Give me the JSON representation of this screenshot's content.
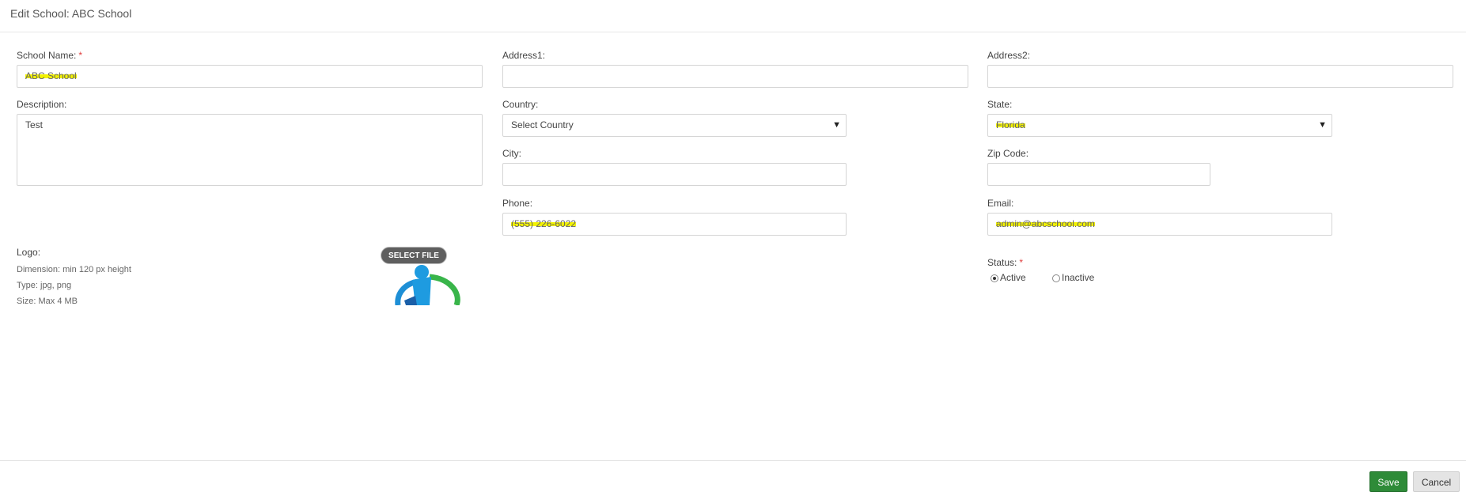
{
  "header": {
    "title": "Edit School: ABC School"
  },
  "form": {
    "school_name": {
      "label": "School Name:",
      "value": "ABC School",
      "required": "*"
    },
    "description": {
      "label": "Description:",
      "value": "Test"
    },
    "address1": {
      "label": "Address1:",
      "value": ""
    },
    "address2": {
      "label": "Address2:",
      "value": ""
    },
    "country": {
      "label": "Country:",
      "value": "Select Country"
    },
    "state": {
      "label": "State:",
      "value": "Florida"
    },
    "city": {
      "label": "City:",
      "value": ""
    },
    "zip": {
      "label": "Zip Code:",
      "value": ""
    },
    "phone": {
      "label": "Phone:",
      "value": "(555) 226-6022"
    },
    "email": {
      "label": "Email:",
      "value": "admin@abcschool.com"
    },
    "logo": {
      "label": "Logo:",
      "dimension": "Dimension: min 120 px height",
      "type": "Type: jpg, png",
      "size": "Size: Max 4 MB",
      "select_file_label": "SELECT FILE"
    },
    "status": {
      "label": "Status:",
      "required": "*",
      "options": [
        "Active",
        "Inactive"
      ],
      "selected": "Active"
    }
  },
  "footer": {
    "save_label": "Save",
    "cancel_label": "Cancel"
  },
  "colors": {
    "save": "#2e8b38",
    "required": "#e04040",
    "highlight": "#f2f200"
  },
  "icons": {
    "dropdown": "chevron-down-icon"
  }
}
